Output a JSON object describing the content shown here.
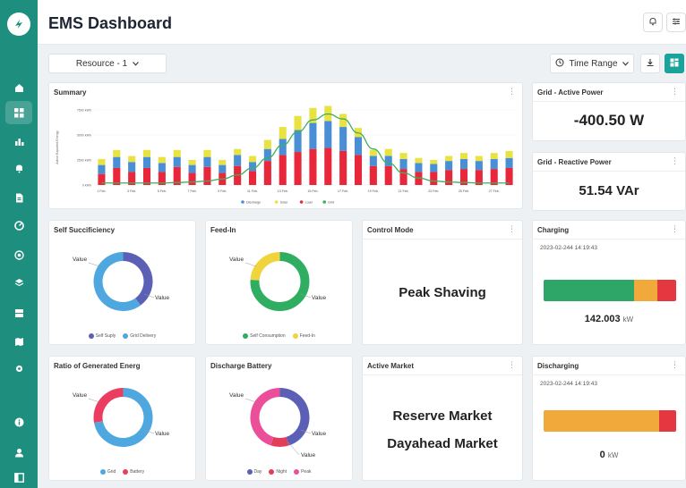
{
  "header": {
    "title": "EMS Dashboard"
  },
  "toolbar": {
    "resource": "Resource - 1",
    "time_range": "Time Range"
  },
  "summary": {
    "title": "Summary",
    "chart_data": {
      "type": "bar",
      "title": "Summary",
      "ylabel": "Active Exported Energy",
      "ylim": [
        0,
        7500
      ],
      "yticks": [
        "7500 kWh",
        "5000 kWh",
        "2500 kWh",
        "0 kWh"
      ],
      "yticks_values": [
        7500,
        5000,
        2500,
        0
      ],
      "x_tick_labels": [
        "1 Feb.",
        "3 Feb.",
        "5 Feb.",
        "7 Feb.",
        "9 Feb.",
        "11 Feb.",
        "13 Feb.",
        "15 Feb.",
        "17 Feb.",
        "19 Feb.",
        "21 Feb.",
        "23 Feb.",
        "25 Feb.",
        "27 Feb."
      ],
      "stacked": true,
      "series": [
        {
          "name": "Discharge",
          "color": "#4a8fd6",
          "values": [
            900,
            1100,
            1000,
            1100,
            900,
            1000,
            800,
            1000,
            800,
            1100,
            900,
            1200,
            1600,
            2200,
            2600,
            2700,
            2400,
            1800,
            1000,
            1000,
            1000,
            900,
            800,
            900,
            1000,
            900,
            1000,
            1000
          ]
        },
        {
          "name": "Solar",
          "color": "#e8e343",
          "values": [
            600,
            700,
            600,
            700,
            600,
            700,
            500,
            700,
            500,
            600,
            600,
            900,
            1200,
            1400,
            1500,
            1500,
            1300,
            900,
            600,
            700,
            600,
            500,
            400,
            500,
            600,
            500,
            600,
            700
          ]
        },
        {
          "name": "Load",
          "color": "#e8283a",
          "values": [
            1100,
            1700,
            1300,
            1700,
            1300,
            1800,
            1200,
            1800,
            1200,
            1900,
            1400,
            2400,
            3000,
            3300,
            3600,
            3700,
            3400,
            3000,
            1900,
            1900,
            1600,
            1300,
            1300,
            1500,
            1600,
            1500,
            1600,
            1700
          ]
        },
        {
          "name": "Grid",
          "color": "#3fae5a",
          "type": "line",
          "values": [
            200,
            200,
            200,
            200,
            200,
            250,
            300,
            400,
            600,
            1000,
            1700,
            2700,
            4000,
            5300,
            6500,
            7100,
            6600,
            5200,
            3600,
            2200,
            1200,
            700,
            400,
            300,
            250,
            200,
            200,
            200
          ]
        }
      ]
    }
  },
  "grid_active": {
    "title": "Grid - Active Power",
    "value": "-400.50 W"
  },
  "grid_reactive": {
    "title": "Grid - Reactive Power",
    "value": "51.54 VAr"
  },
  "self_sufficiency": {
    "title": "Self Succificiency",
    "label_top": "Value",
    "label_side": "Value",
    "slices": [
      {
        "name": "Self Suply",
        "value": 40,
        "color": "#5b5fb5"
      },
      {
        "name": "Grid Delivery",
        "value": 60,
        "color": "#4fa7e0"
      }
    ]
  },
  "feed_in": {
    "title": "Feed-In",
    "label_top": "Value",
    "label_side": "Value",
    "slices": [
      {
        "name": "Self Consumption",
        "value": 76,
        "color": "#2fae62"
      },
      {
        "name": "Feed-In",
        "value": 24,
        "color": "#f1d33c"
      }
    ]
  },
  "control_mode": {
    "title": "Control Mode",
    "value": "Peak Shaving"
  },
  "charging": {
    "title": "Charging",
    "timestamp": "2023-02-244 14:19:43",
    "value": "142.003",
    "unit": "kW",
    "segments": [
      {
        "value": 68,
        "color": "#2ea667"
      },
      {
        "value": 18,
        "color": "#f2a93b"
      },
      {
        "value": 14,
        "color": "#e5373f"
      }
    ]
  },
  "ratio_generated": {
    "title": "Ratio of Generated Energ",
    "label_top": "Value",
    "label_side": "Value",
    "slices": [
      {
        "name": "Grid",
        "value": 72,
        "color": "#4fa7e0"
      },
      {
        "name": "Battery",
        "value": 28,
        "color": "#ea3d5f"
      }
    ]
  },
  "discharge_battery": {
    "title": "Discharge Battery",
    "label_top": "Value",
    "label_side": "Value",
    "label_bottom": "Value",
    "slices": [
      {
        "name": "Day",
        "value": 45,
        "color": "#5b5fb5"
      },
      {
        "name": "Night",
        "value": 10,
        "color": "#e43d5a"
      },
      {
        "name": "Peak",
        "value": 45,
        "color": "#ec4f9a"
      }
    ]
  },
  "active_market": {
    "title": "Active Market",
    "line1": "Reserve Market",
    "line2": "Dayahead Market"
  },
  "discharging": {
    "title": "Discharging",
    "timestamp": "2023-02-244 14:19:43",
    "value": "0",
    "unit": "kW",
    "segments": [
      {
        "value": 87,
        "color": "#f2a93b"
      },
      {
        "value": 13,
        "color": "#e5373f"
      }
    ]
  },
  "colors": {
    "sidebar": "#1e8f7e",
    "accent": "#1aa39a"
  },
  "icons": {
    "logo": "logo-icon",
    "sidebar": [
      "home-icon",
      "dashboard-grid-icon",
      "bar-chart-icon",
      "bell-icon",
      "document-icon",
      "gauge-icon",
      "target-icon",
      "layers-icon",
      "server-icon",
      "map-icon",
      "settings-icon",
      "info-icon",
      "user-icon",
      "sidebar-toggle-icon"
    ]
  }
}
